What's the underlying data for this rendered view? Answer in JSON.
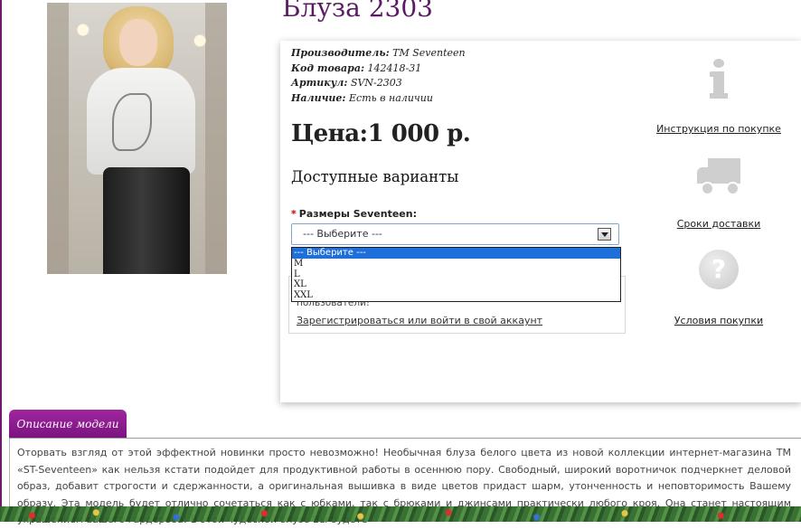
{
  "product": {
    "title": "Блуза 2303",
    "meta": [
      {
        "label": "Производитель:",
        "value": "ТМ Seventeen"
      },
      {
        "label": "Код товара:",
        "value": "142418-31"
      },
      {
        "label": "Артикул:",
        "value": "SVN-2303"
      },
      {
        "label": "Наличие:",
        "value": "Есть в наличии"
      }
    ],
    "price": "Цена:1 000 р.",
    "variants_title": "Доступные варианты",
    "size_label": "Размеры Seventeen:",
    "size_select_value": "--- Выберите ---",
    "size_options": [
      "--- Выберите ---",
      "M",
      "L",
      "XL",
      "XXL"
    ]
  },
  "login": {
    "message": "пользователи!",
    "link": "Зарегистрироваться или войти в свой аккаунт"
  },
  "side": {
    "instructions": "Инструкция по покупке",
    "delivery": "Сроки доставки",
    "conditions": "Условия покупки"
  },
  "description": {
    "tab": "Описание модели",
    "text": "Оторвать взгляд от этой эффектной новинки просто невозможно! Необычная блуза белого цвета из новой коллекции интернет-магазина ТМ «ST-Seventeen» как нельзя кстати подойдет для продуктивной работы в осеннюю пору. Свободный, широкий воротничок подчеркнет деловой образ, добавит строгости и сдержанности, а оригинальная вышивка в виде цветов придаст шарм, утонченность и неповторимость Вашему образу. Эта модель будет отлично сочетаться как с юбками, так с брюками и джинсами практически любого кроя. Она станет настоящим украшением вашего гардероба! В этой чудесной блузе Вы будете"
  },
  "colors": {
    "accent": "#5a1a64",
    "tab": "#8e1a91",
    "selected_option": "#1e6fd9"
  }
}
